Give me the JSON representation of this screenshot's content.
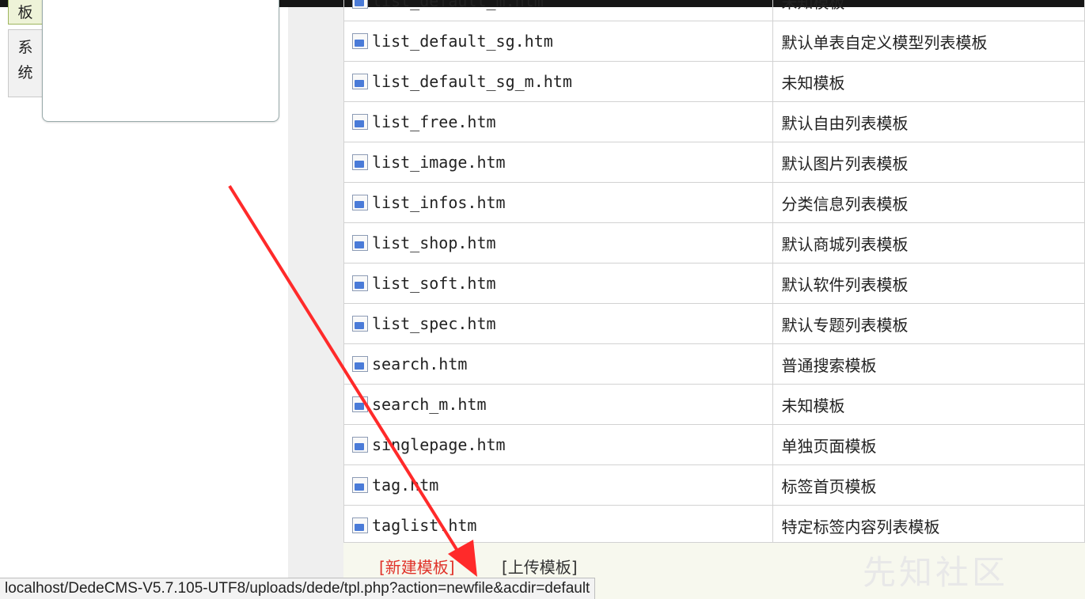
{
  "sidebar": {
    "tabs": [
      {
        "label": "板"
      },
      {
        "label": "系统"
      }
    ]
  },
  "files": [
    {
      "name": "list_default_m.htm",
      "desc": "未知模板"
    },
    {
      "name": "list_default_sg.htm",
      "desc": "默认单表自定义模型列表模板"
    },
    {
      "name": "list_default_sg_m.htm",
      "desc": "未知模板"
    },
    {
      "name": "list_free.htm",
      "desc": "默认自由列表模板"
    },
    {
      "name": "list_image.htm",
      "desc": "默认图片列表模板"
    },
    {
      "name": "list_infos.htm",
      "desc": "分类信息列表模板"
    },
    {
      "name": "list_shop.htm",
      "desc": "默认商城列表模板"
    },
    {
      "name": "list_soft.htm",
      "desc": "默认软件列表模板"
    },
    {
      "name": "list_spec.htm",
      "desc": "默认专题列表模板"
    },
    {
      "name": "search.htm",
      "desc": "普通搜索模板"
    },
    {
      "name": "search_m.htm",
      "desc": "未知模板"
    },
    {
      "name": "singlepage.htm",
      "desc": "单独页面模板"
    },
    {
      "name": "tag.htm",
      "desc": "标签首页模板"
    },
    {
      "name": "taglist.htm",
      "desc": "特定标签内容列表模板"
    }
  ],
  "actions": {
    "new_template": "[新建模板]",
    "upload_template": "[上传模板]"
  },
  "status_bar": {
    "url": "localhost/DedeCMS-V5.7.105-UTF8/uploads/dede/tpl.php?action=newfile&acdir=default"
  },
  "watermark": "先知社区",
  "colors": {
    "link_red": "#e0332a",
    "annotation_arrow": "#ff2a2a",
    "action_row_bg": "#f7f8ee"
  }
}
